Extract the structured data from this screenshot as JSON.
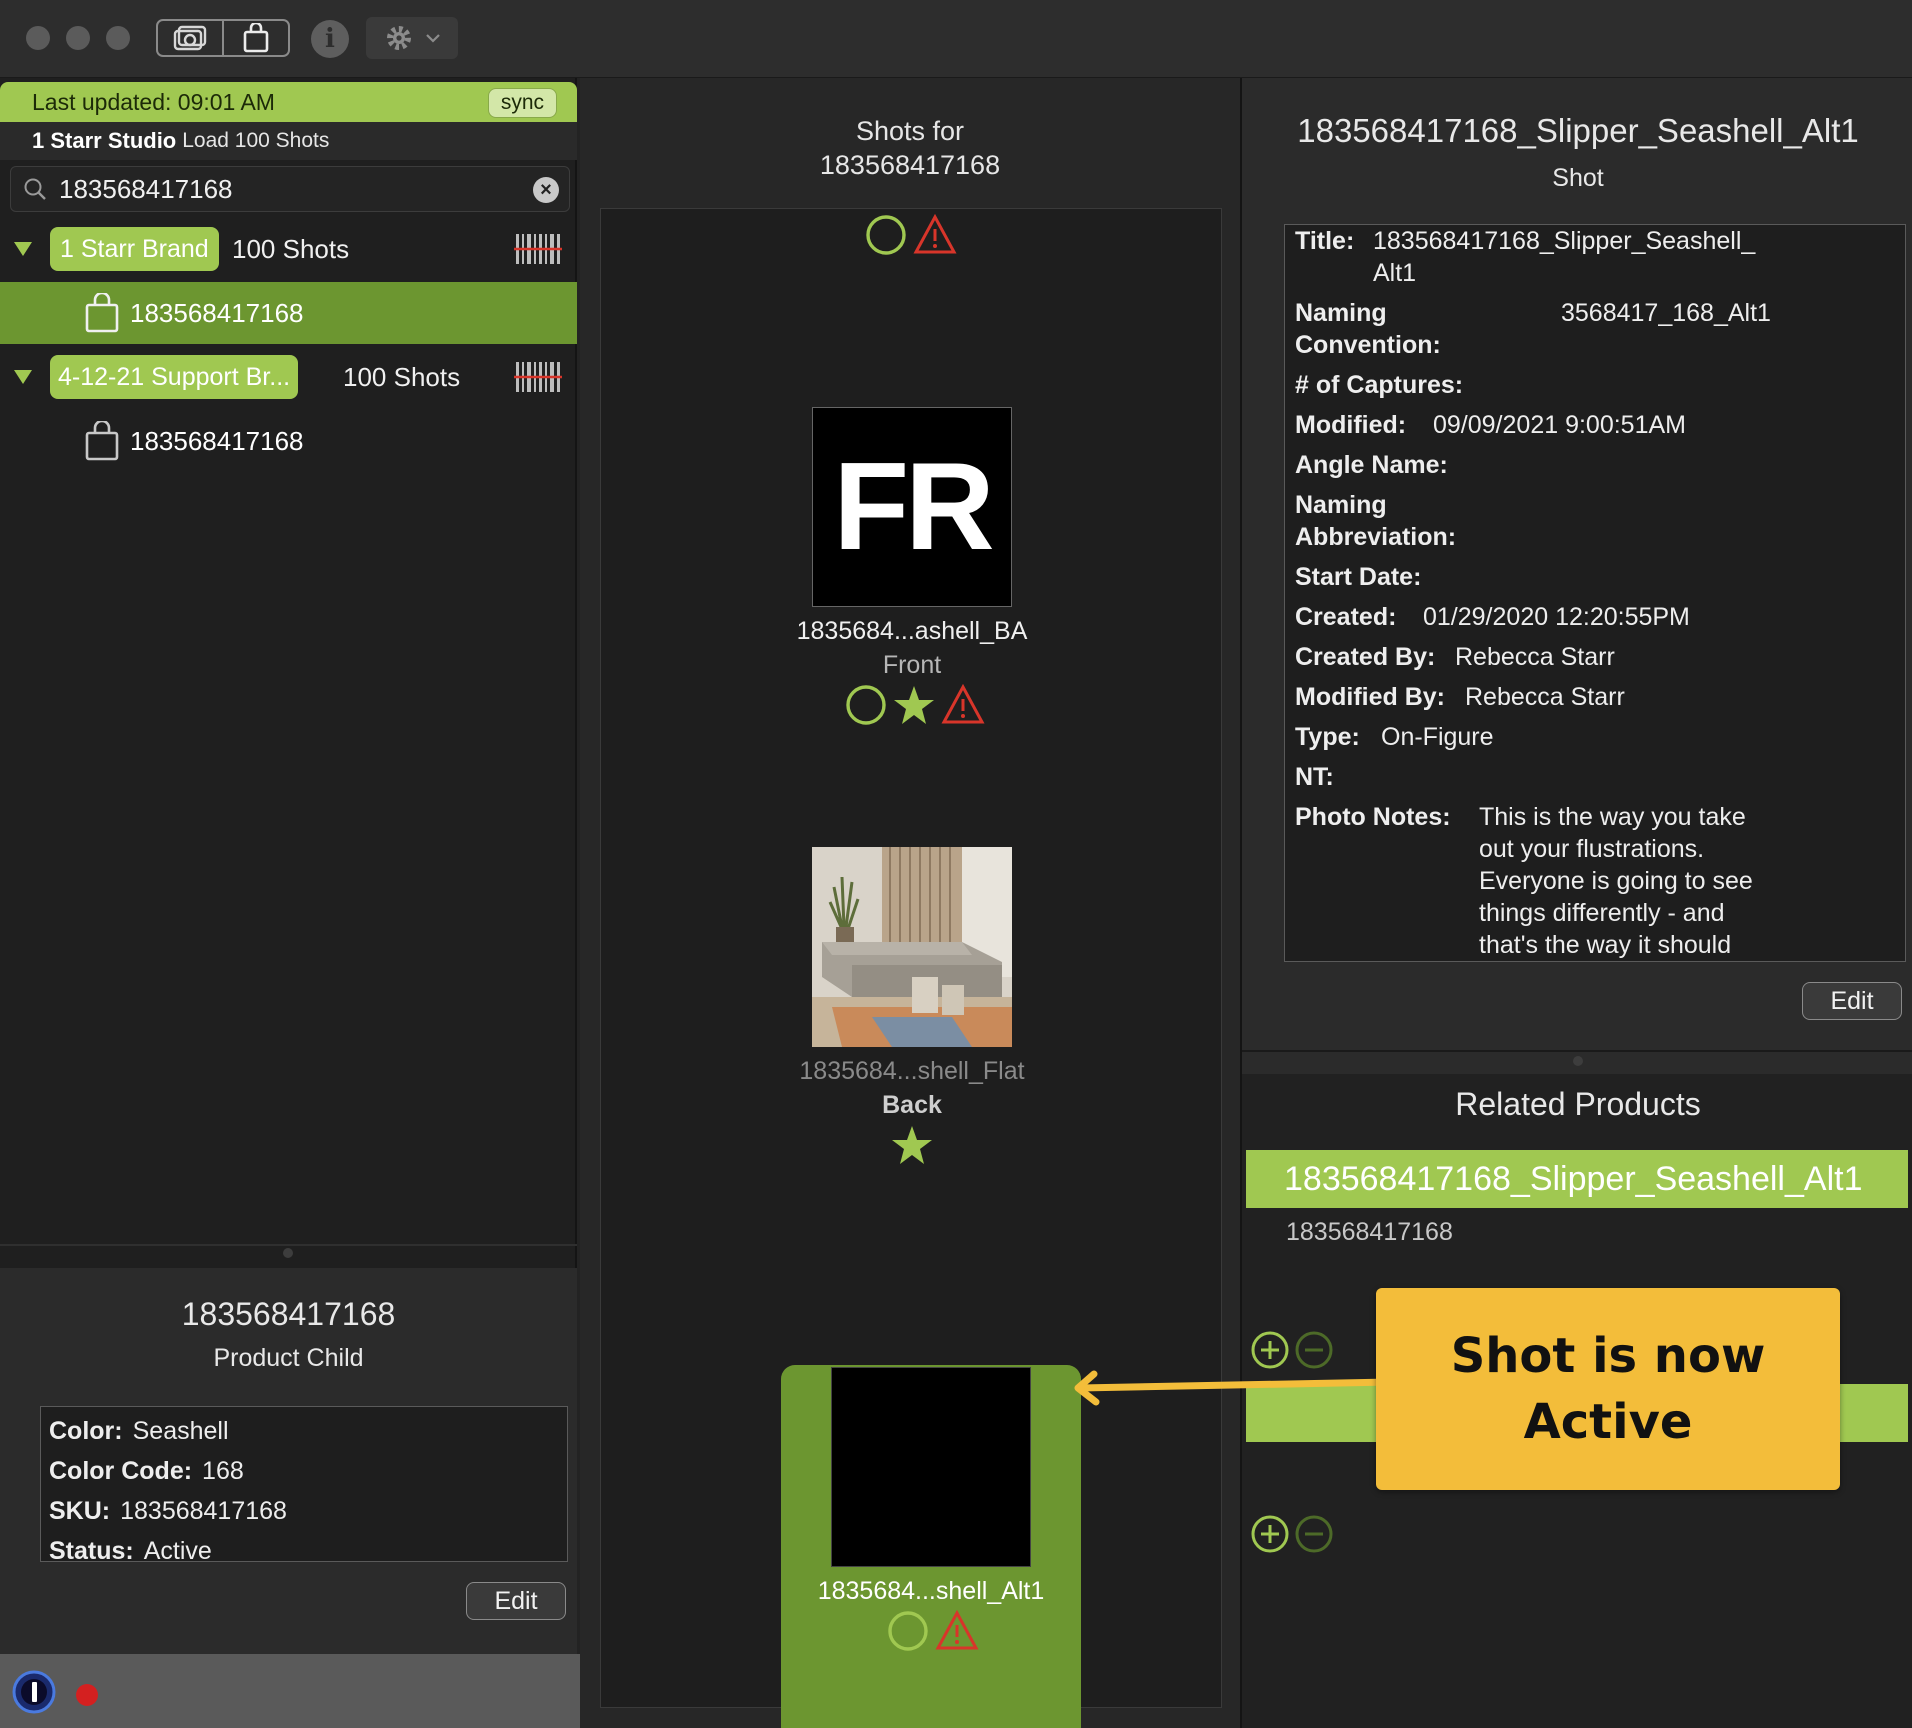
{
  "colors": {
    "accent_green": "#a0c851",
    "selected_green": "#6c9630",
    "warning_red": "#d8352a",
    "callout_yellow": "#f3bd3a"
  },
  "toolbar": {
    "segment_icons": [
      "camera-stack-icon",
      "bag-icon"
    ],
    "info_icon": "info-icon",
    "settings_icon": "gear-icon"
  },
  "left": {
    "last_updated": "Last updated: 09:01 AM",
    "sync_label": "sync",
    "studio_name": "1 Starr Studio",
    "studio_action": "Load 100 Shots",
    "search_value": "183568417168",
    "brands": [
      {
        "name": "1 Starr Brand",
        "count": "100 Shots",
        "child": "183568417168"
      },
      {
        "name": "4-12-21 Support Br...",
        "count": "100 Shots",
        "child": "183568417168"
      }
    ],
    "detail": {
      "title": "183568417168",
      "subtitle": "Product Child",
      "color_label": "Color:",
      "color_value": "Seashell",
      "code_label": "Color Code:",
      "code_value": "168",
      "sku_label": "SKU:",
      "sku_value": "183568417168",
      "status_label": "Status:",
      "status_value": "Active",
      "edit_label": "Edit"
    }
  },
  "middle": {
    "title_line1": "Shots for",
    "title_line2": "183568417168",
    "shots": [
      {
        "thumb_text": "FR",
        "name": "1835684...ashell_BA",
        "angle": "Front"
      },
      {
        "name": "1835684...shell_Flat",
        "angle": "Back"
      },
      {
        "name": "1835684...shell_Alt1"
      }
    ]
  },
  "right": {
    "title": "183568417168_Slipper_Seashell_Alt1",
    "subtitle": "Shot",
    "fields": {
      "title_label": "Title:",
      "title_value_1": "183568417168_Slipper_Seashell_",
      "title_value_2": "Alt1",
      "naming_label_1": "Naming",
      "naming_label_2": "Convention:",
      "naming_value": "3568417_168_Alt1",
      "captures_label": "# of Captures:",
      "modified_label": "Modified:",
      "modified_value": "09/09/2021 9:00:51AM",
      "angle_label": "Angle Name:",
      "abbr_label_1": "Naming",
      "abbr_label_2": "Abbreviation:",
      "start_label": "Start Date:",
      "created_label": "Created:",
      "created_value": "01/29/2020 12:20:55PM",
      "created_by_label": "Created By:",
      "created_by_value": "Rebecca Starr",
      "modified_by_label": "Modified By:",
      "modified_by_value": "Rebecca Starr",
      "type_label": "Type:",
      "type_value": "On-Figure",
      "nt_label": "NT:",
      "notes_label": "Photo Notes:",
      "notes_lines": [
        "This is the way you take",
        "out your flustrations.",
        "Everyone is going to see",
        "things differently - and",
        "that's the way it should"
      ]
    },
    "edit_label": "Edit",
    "related_title": "Related Products",
    "related_selected": "183568417168_Slipper_Seashell_Alt1",
    "related_item": "183568417168"
  },
  "callout": {
    "line1": "Shot is now",
    "line2": "Active"
  }
}
